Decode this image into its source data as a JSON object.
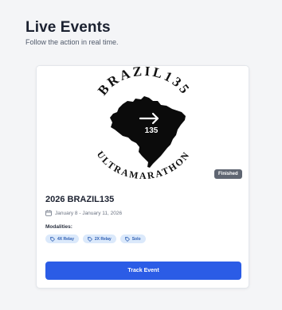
{
  "header": {
    "title": "Live Events",
    "subtitle": "Follow the action in real time."
  },
  "event_card": {
    "image": {
      "logo_text_top": "BRAZIL135",
      "logo_text_bottom": "ULTRAMARATHON",
      "map_number": "135"
    },
    "status_badge": "Finished",
    "title": "2026 BRAZIL135",
    "date_range": "January 8 - January 11, 2026",
    "modalities_label": "Modalities:",
    "modalities": [
      "4X Relay",
      "2X Relay",
      "Solo"
    ],
    "track_button_label": "Track Event"
  },
  "colors": {
    "accent": "#2b5ce6",
    "chip_background": "#dbe9fb",
    "chip_text": "#2f5fb3",
    "badge_background": "#5f6672",
    "page_background": "#f4f5f7"
  },
  "icons": {
    "calendar": "calendar-icon",
    "modality": "tag-icon",
    "map_arrow": "arrow-right-icon"
  }
}
